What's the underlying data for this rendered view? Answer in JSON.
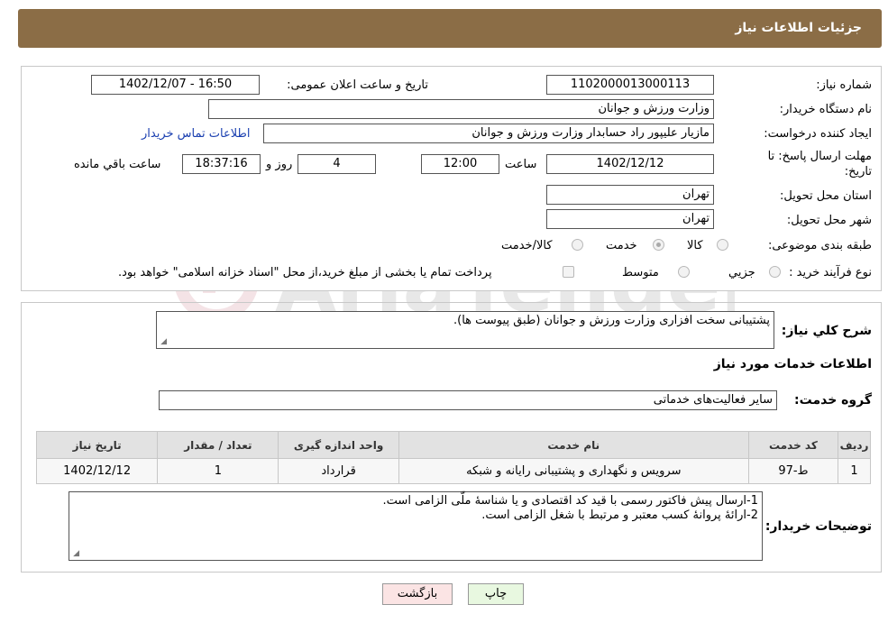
{
  "header": {
    "title": "جزئیات اطلاعات نیاز"
  },
  "form": {
    "need_number": {
      "label": "شماره نیاز:",
      "value": "1102000013000113"
    },
    "announce_datetime": {
      "label": "تاریخ و ساعت اعلان عمومی:",
      "value": "1402/12/07 - 16:50"
    },
    "buyer_org": {
      "label": "نام دستگاه خریدار:",
      "value": "وزارت ورزش و جوانان"
    },
    "requester": {
      "label": "ایجاد کننده درخواست:",
      "value": "مازیار  علیپور راد حسابدار وزارت ورزش و جوانان",
      "contact_link": "اطلاعات تماس خریدار"
    },
    "deadline": {
      "label_line1": "مهلت ارسال پاسخ: تا",
      "label_line2": "تاریخ:",
      "date": "1402/12/12",
      "time_label": "ساعت",
      "time": "12:00",
      "days": "4",
      "days_label": "روز و",
      "remaining_time": "18:37:16",
      "remaining_label": "ساعت باقي مانده"
    },
    "province": {
      "label": "استان محل تحویل:",
      "value": "تهران"
    },
    "city": {
      "label": "شهر محل تحویل:",
      "value": "تهران"
    },
    "category": {
      "label": "طبقه بندی موضوعی:",
      "options": [
        {
          "label": "کالا",
          "checked": false
        },
        {
          "label": "خدمت",
          "checked": true
        },
        {
          "label": "کالا/خدمت",
          "checked": false
        }
      ]
    },
    "purchase_type": {
      "label": "نوع فرآیند خرید :",
      "options": [
        {
          "label": "جزیي",
          "checked": false
        },
        {
          "label": "متوسط",
          "checked": false
        }
      ],
      "payment_note": "پرداخت تمام یا بخشی از مبلغ خرید،از محل \"اسناد خزانه اسلامی\" خواهد بود.",
      "payment_checked": false
    }
  },
  "details": {
    "description_label": "شرح کلي نیاز:",
    "description": "پشتیبانی سخت افزاری وزارت ورزش و جوانان (طبق پیوست ها).",
    "services_title": "اطلاعات خدمات مورد نیاز",
    "service_group_label": "گروه خدمت:",
    "service_group": "سایر فعالیت‌های خدماتی",
    "table": {
      "headers": [
        "ردیف",
        "کد خدمت",
        "نام خدمت",
        "واحد اندازه گیری",
        "تعداد / مقدار",
        "تاریخ نیاز"
      ],
      "rows": [
        [
          "1",
          "ط-97",
          "سرویس و نگهداری و پشتیبانی رایانه و شبکه",
          "قرارداد",
          "1",
          "1402/12/12"
        ]
      ]
    },
    "buyer_notes_label": "توضیحات خریدار:",
    "buyer_notes_line1": "1-ارسال پیش فاکتور رسمی با قید کد اقتصادی و یا شناسۀ ملّی الزامی است.",
    "buyer_notes_line2": "2-ارائۀ پروانۀ کسب معتبر و مرتبط با شغل الزامی است."
  },
  "buttons": {
    "print": "چاپ",
    "back": "بازگشت"
  },
  "watermark": {
    "text": "AriaTender.neT"
  },
  "colors": {
    "header_bg": "#8b6d46",
    "link": "#1a3fb0",
    "print_bg": "#e8f8e0",
    "back_bg": "#fbe4e4"
  }
}
